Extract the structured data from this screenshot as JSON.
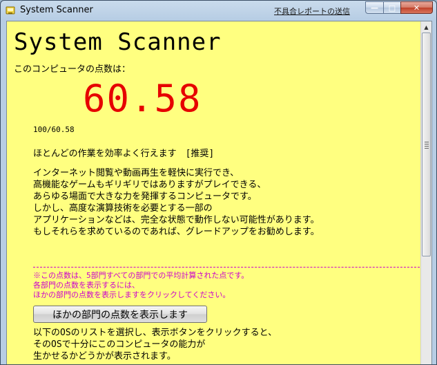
{
  "window": {
    "title": "System Scanner",
    "report_link": "不具合レポートの送信",
    "controls": {
      "minimize": "—",
      "maximize": "□",
      "close": "✕"
    }
  },
  "main": {
    "app_title": "System Scanner",
    "score_label": "このコンピュータの点数は：",
    "score": "60.58",
    "ratio": "100/60.58",
    "verdict": "ほとんどの作業を効率よく行えます　[推奨]",
    "description": [
      "インターネット閲覧や動画再生を軽快に実行でき、",
      "高機能なゲームもギリギリではありますがプレイできる、",
      "あらゆる場面で大きな力を発揮するコンピュータです。",
      "しかし、高度な演算技術を必要とする一部の",
      "アプリケーションなどは、完全な状態で動作しない可能性があります。",
      "もしそれらを求めているのであれば、グレードアップをお勧めします。"
    ],
    "note": [
      "※この点数は、5部門すべての部門での平均計算された点です。",
      "各部門の点数を表示するには、",
      "ほかの部門の点数を表示しますをクリックしてください。"
    ],
    "show_button": "ほかの部門の点数を表示します",
    "os_description": [
      "以下のOSのリストを選択し、表示ボタンをクリックすると、",
      "そのOSで十分にこのコンピュータの能力が",
      "生かせるかどうかが表示されます。"
    ]
  },
  "colors": {
    "background": "#ffff80",
    "score": "#e60000",
    "note": "#cc00cc"
  },
  "icons": {
    "app": "scanner-app-icon",
    "scroll_up": "scroll-up-arrow-icon"
  }
}
